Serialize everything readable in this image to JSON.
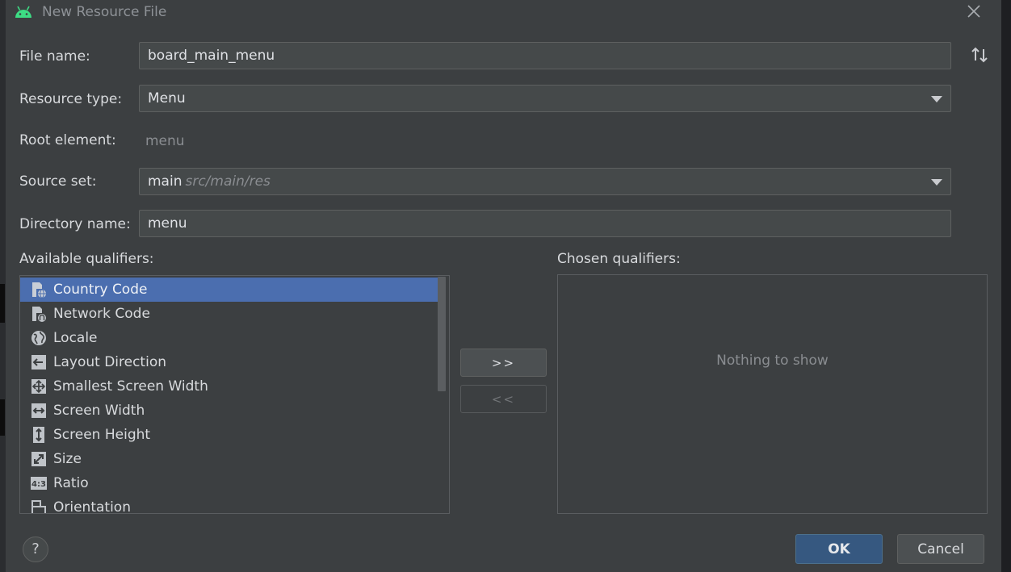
{
  "window": {
    "title": "New Resource File"
  },
  "form": {
    "file_name": {
      "label": "File name:",
      "value": "board_main_menu"
    },
    "resource_type": {
      "label": "Resource type:",
      "value": "Menu"
    },
    "root_element": {
      "label": "Root element:",
      "value": "menu"
    },
    "source_set": {
      "label": "Source set:",
      "value": "main",
      "hint": "src/main/res"
    },
    "directory_name": {
      "label": "Directory name:",
      "value": "menu"
    }
  },
  "available": {
    "label": "Available qualifiers:",
    "items": [
      {
        "label": "Country Code",
        "icon": "country-code-icon",
        "selected": true
      },
      {
        "label": "Network Code",
        "icon": "network-code-icon",
        "selected": false
      },
      {
        "label": "Locale",
        "icon": "globe-icon",
        "selected": false
      },
      {
        "label": "Layout Direction",
        "icon": "layout-direction-icon",
        "selected": false
      },
      {
        "label": "Smallest Screen Width",
        "icon": "smallest-width-icon",
        "selected": false
      },
      {
        "label": "Screen Width",
        "icon": "screen-width-icon",
        "selected": false
      },
      {
        "label": "Screen Height",
        "icon": "screen-height-icon",
        "selected": false
      },
      {
        "label": "Size",
        "icon": "size-icon",
        "selected": false
      },
      {
        "label": "Ratio",
        "icon": "ratio-icon",
        "selected": false
      },
      {
        "label": "Orientation",
        "icon": "orientation-icon",
        "selected": false
      }
    ]
  },
  "buttons": {
    "add": ">>",
    "remove": "<<",
    "ok": "OK",
    "cancel": "Cancel",
    "help": "?"
  },
  "chosen": {
    "label": "Chosen qualifiers:",
    "empty": "Nothing to show"
  },
  "colors": {
    "dialog_bg": "#3c3f41",
    "selection": "#4b6eaf",
    "ok_button": "#365880",
    "android_green": "#3ddc84"
  }
}
